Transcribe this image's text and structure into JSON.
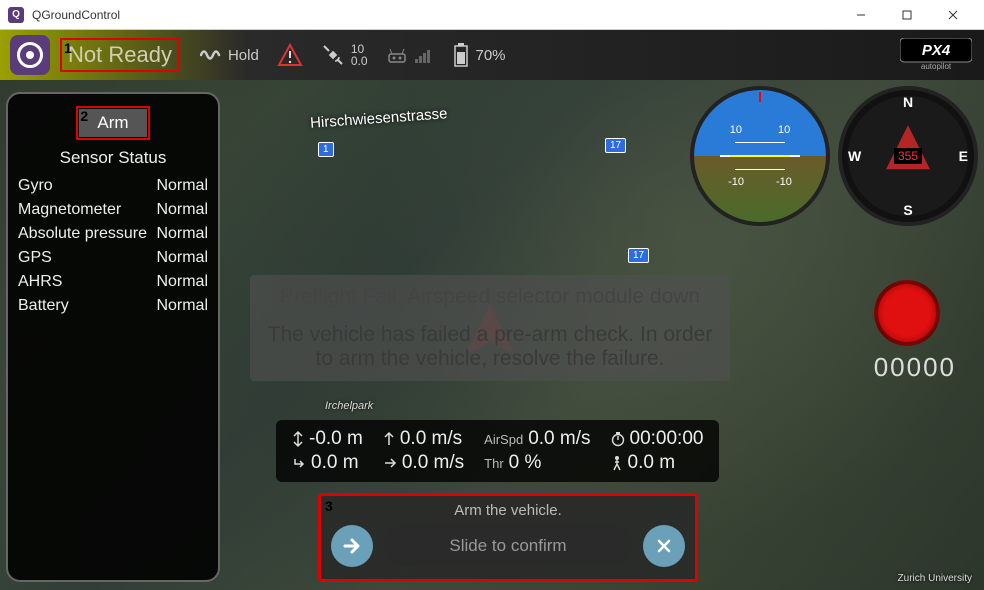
{
  "window": {
    "title": "QGroundControl"
  },
  "toolbar": {
    "status": "Not Ready",
    "mode": "Hold",
    "gps": {
      "sat": "10",
      "hdop": "0.0"
    },
    "battery": "70%"
  },
  "brand": "PX4 autopilot",
  "annotations": {
    "box1": "1",
    "box2": "2",
    "box3": "3"
  },
  "sensor": {
    "arm_label": "Arm",
    "title": "Sensor Status",
    "rows": [
      {
        "name": "Gyro",
        "status": "Normal"
      },
      {
        "name": "Magnetometer",
        "status": "Normal"
      },
      {
        "name": "Absolute pressure",
        "status": "Normal"
      },
      {
        "name": "GPS",
        "status": "Normal"
      },
      {
        "name": "AHRS",
        "status": "Normal"
      },
      {
        "name": "Battery",
        "status": "Normal"
      }
    ]
  },
  "alert": {
    "line1": "Preflight Fail: Airspeed selector module down",
    "line2": "The vehicle has failed a pre-arm check. In order to arm the vehicle, resolve the failure."
  },
  "compass": {
    "n": "N",
    "s": "S",
    "e": "E",
    "w": "W",
    "heading": "355"
  },
  "horizon": {
    "up": "10",
    "down": "-10"
  },
  "record": {
    "time": "00000"
  },
  "telemetry": {
    "alt": "-0.0 m",
    "vspeed": "0.0 m/s",
    "airspd_label": "AirSpd",
    "airspd": "0.0 m/s",
    "flight_time": "00:00:00",
    "dist": "0.0 m",
    "gspeed": "0.0 m/s",
    "thr_label": "Thr",
    "thr": "0 %",
    "walk": "0.0 m"
  },
  "confirm": {
    "title": "Arm the vehicle.",
    "slide": "Slide to confirm"
  },
  "map": {
    "street": "Hirschwiesenstrasse",
    "park": "Irchelpark",
    "copyright": "Zurich University",
    "badge1": "1",
    "badge17a": "17",
    "badge17b": "17"
  }
}
